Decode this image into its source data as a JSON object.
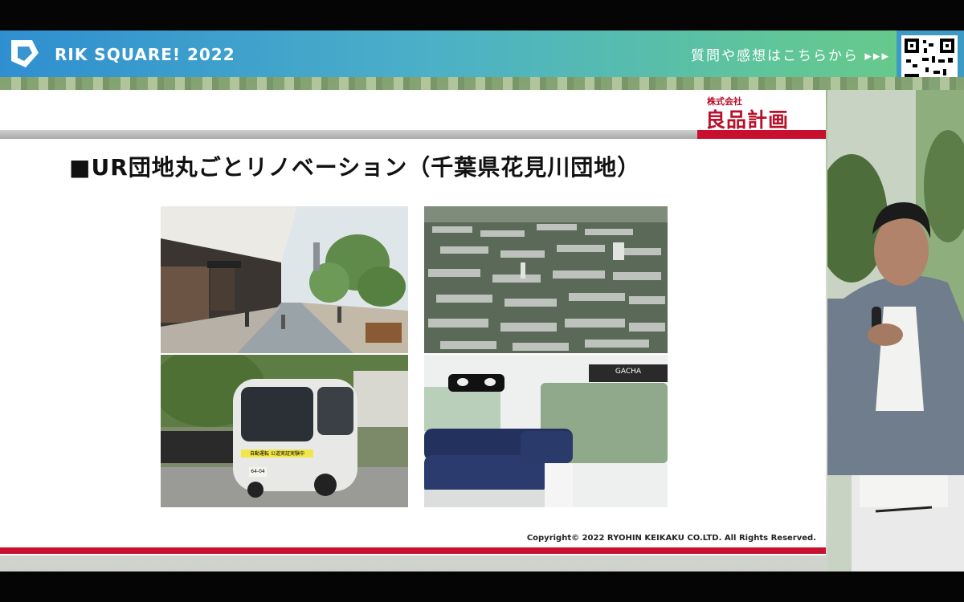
{
  "header": {
    "brand": "RIK SQUARE! 2022",
    "question_prompt": "質問や感想はこちらから ▸▸▸",
    "qr_icon": "qr-code-icon"
  },
  "slide": {
    "logo_small": "株式会社",
    "logo_big": "良品計画",
    "title": "■UR団地丸ごとリノベーション（千葉県花見川団地）",
    "bus_sign": "自動運転 公道実証実験中",
    "bus_plate": "64-04",
    "interior_sign": "GACHA",
    "copyright": "Copyright© 2022 RYOHIN KEIKAKU CO.LTD. All Rights Reserved."
  },
  "colors": {
    "accent_red": "#c8102e",
    "header_blue": "#2f8fd0",
    "header_green": "#6bcb83"
  }
}
